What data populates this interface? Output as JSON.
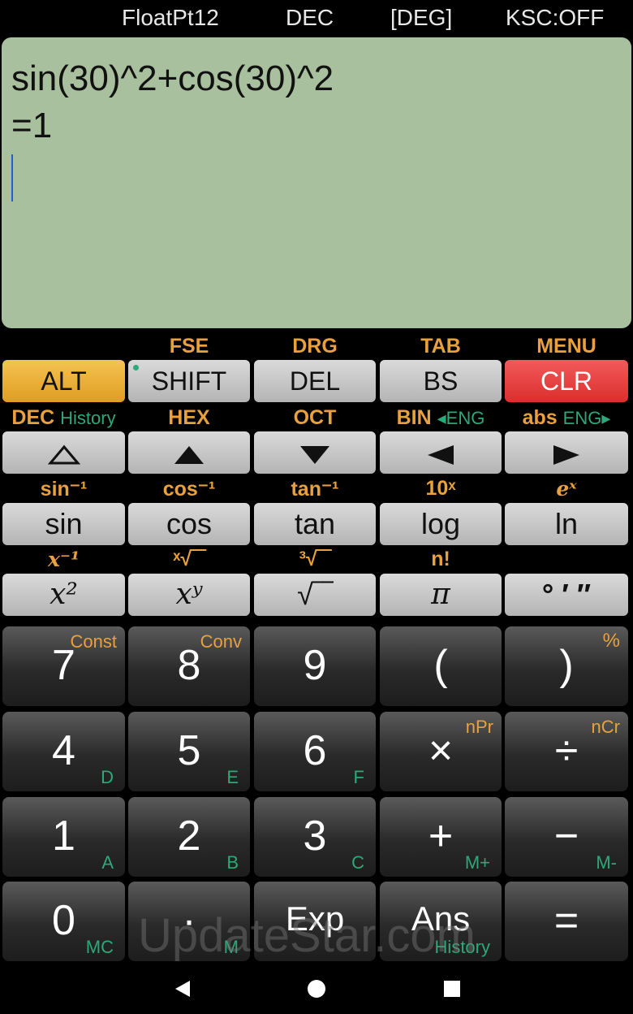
{
  "status": {
    "float_mode": "FloatPt12",
    "base": "DEC",
    "angle": "[DEG]",
    "ksc": "KSC:OFF"
  },
  "display": {
    "expression": "sin(30)^2+cos(30)^2",
    "result": "=1"
  },
  "row_function": {
    "labels": [
      "FSE",
      "DRG",
      "TAB",
      "MENU"
    ],
    "keys": [
      "ALT",
      "SHIFT",
      "DEL",
      "BS",
      "CLR"
    ]
  },
  "row_nav": {
    "labels": {
      "dec": "DEC",
      "history": "History",
      "hex": "HEX",
      "oct": "OCT",
      "bin": "BIN",
      "eng_left": "◂ENG",
      "abs": "abs",
      "eng_right": "ENG▸"
    }
  },
  "row_trig": {
    "labels": [
      "sin⁻¹",
      "cos⁻¹",
      "tan⁻¹",
      "10ˣ",
      "eˣ"
    ],
    "keys": [
      "sin",
      "cos",
      "tan",
      "log",
      "ln"
    ]
  },
  "row_power": {
    "labels": [
      "x⁻¹",
      "ˣ√‾‾",
      "³√‾‾",
      "n!"
    ],
    "keys": [
      "x²",
      "xʸ",
      "√‾‾",
      "π",
      "° ′ ″"
    ]
  },
  "numpad": [
    [
      {
        "main": "7",
        "alt": "Const"
      },
      {
        "main": "8",
        "alt": "Conv"
      },
      {
        "main": "9"
      },
      {
        "main": "("
      },
      {
        "main": ")",
        "alt": "%"
      }
    ],
    [
      {
        "main": "4",
        "hex": "D"
      },
      {
        "main": "5",
        "hex": "E"
      },
      {
        "main": "6",
        "hex": "F"
      },
      {
        "main": "×",
        "alt": "nPr"
      },
      {
        "main": "÷",
        "alt": "nCr"
      }
    ],
    [
      {
        "main": "1",
        "hex": "A"
      },
      {
        "main": "2",
        "hex": "B"
      },
      {
        "main": "3",
        "hex": "C"
      },
      {
        "main": "+",
        "hex": "M+"
      },
      {
        "main": "−",
        "hex": "M-"
      }
    ],
    [
      {
        "main": "0",
        "hex": "MC"
      },
      {
        "main": "·",
        "hex": "M"
      },
      {
        "main": "Exp"
      },
      {
        "main": "Ans",
        "hex": "History"
      },
      {
        "main": "="
      }
    ]
  ],
  "watermark": "UpdateStar.com"
}
